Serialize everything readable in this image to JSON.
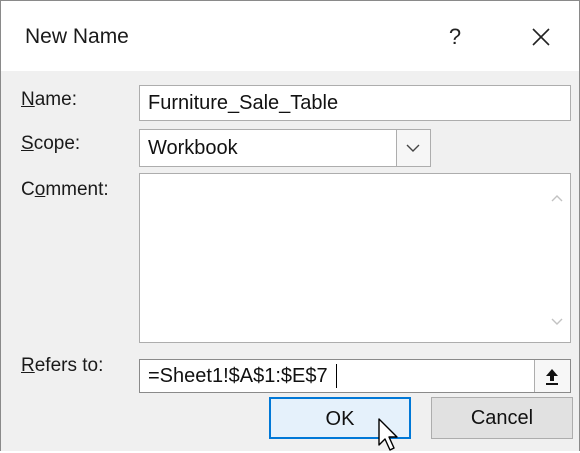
{
  "dialog": {
    "title": "New Name",
    "help_label": "?",
    "close_icon": "close-icon"
  },
  "fields": {
    "name": {
      "label": "Name:",
      "value": "Furniture_Sale_Table"
    },
    "scope": {
      "label": "Scope:",
      "value": "Workbook"
    },
    "comment": {
      "label": "Comment:",
      "value": ""
    },
    "refers_to": {
      "label": "Refers to:",
      "value": "=Sheet1!$A$1:$E$7"
    }
  },
  "buttons": {
    "ok": "OK",
    "cancel": "Cancel"
  },
  "colors": {
    "ok_border": "#0078d7",
    "dialog_bg": "#f0f0f0"
  }
}
